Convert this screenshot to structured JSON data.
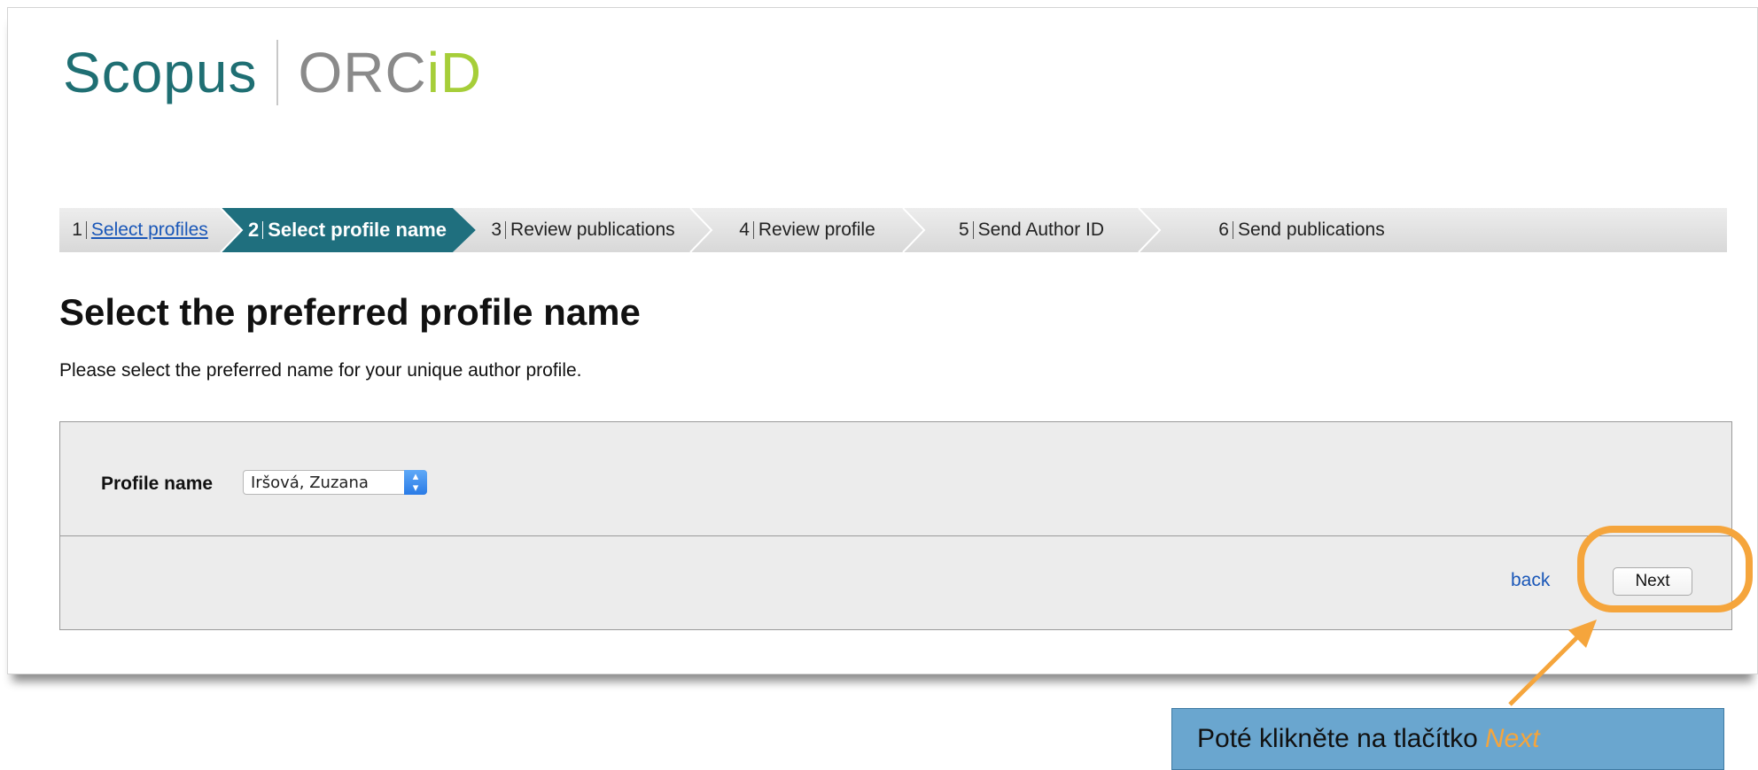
{
  "logo": {
    "scopus": "Scopus",
    "orcid_prefix": "ORC",
    "orcid_id": "iD"
  },
  "steps": [
    {
      "num": "1",
      "label": "Select profiles",
      "state": "link"
    },
    {
      "num": "2",
      "label": "Select profile name",
      "state": "active"
    },
    {
      "num": "3",
      "label": "Review publications",
      "state": "inactive"
    },
    {
      "num": "4",
      "label": "Review profile",
      "state": "inactive"
    },
    {
      "num": "5",
      "label": "Send Author ID",
      "state": "inactive"
    },
    {
      "num": "6",
      "label": "Send publications",
      "state": "inactive"
    }
  ],
  "page": {
    "title": "Select the preferred profile name",
    "description": "Please select the preferred name for your unique author profile."
  },
  "form": {
    "profile_name_label": "Profile name",
    "profile_name_value": "Iršová, Zuzana"
  },
  "actions": {
    "back_label": "back",
    "next_label": "Next"
  },
  "callout": {
    "text": "Poté klikněte na tlačítko",
    "emphasis": "Next"
  },
  "colors": {
    "step_active": "#1f6f7e",
    "step_inactive": "#e2e2e2",
    "annotation": "#f5a53c",
    "callout_bg": "#6aa6cf",
    "link": "#1a57b8"
  }
}
